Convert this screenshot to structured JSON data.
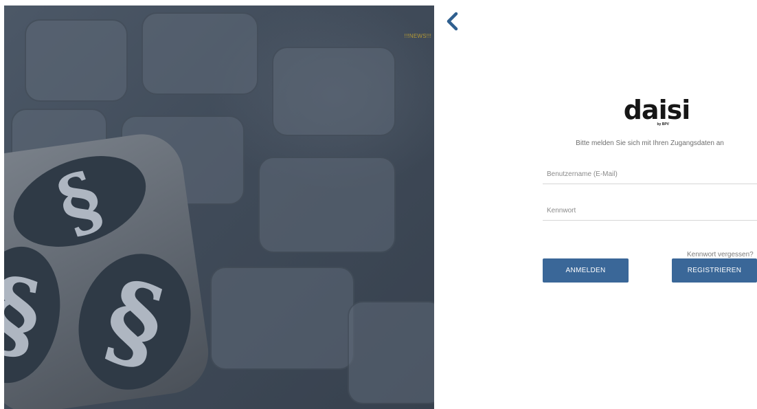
{
  "hero": {
    "news_label": "!!!NEWS!!!",
    "image_alt_icon": "paragraph-dice-on-keyboard-image"
  },
  "nav": {
    "back_icon": "chevron-left-icon"
  },
  "logo": {
    "main_text": "daisi",
    "sub_text": "by BPV"
  },
  "login": {
    "prompt": "Bitte melden Sie sich mit Ihren Zugangsdaten an",
    "username_placeholder": "Benutzername (E-Mail)",
    "password_placeholder": "Kennwort",
    "forgot_label": "Kennwort vergessen?",
    "login_label": "ANMELDEN",
    "register_label": "REGISTRIEREN"
  },
  "colors": {
    "accent": "#3a6798",
    "news": "#b59a35",
    "back_arrow": "#2f5f8f"
  }
}
